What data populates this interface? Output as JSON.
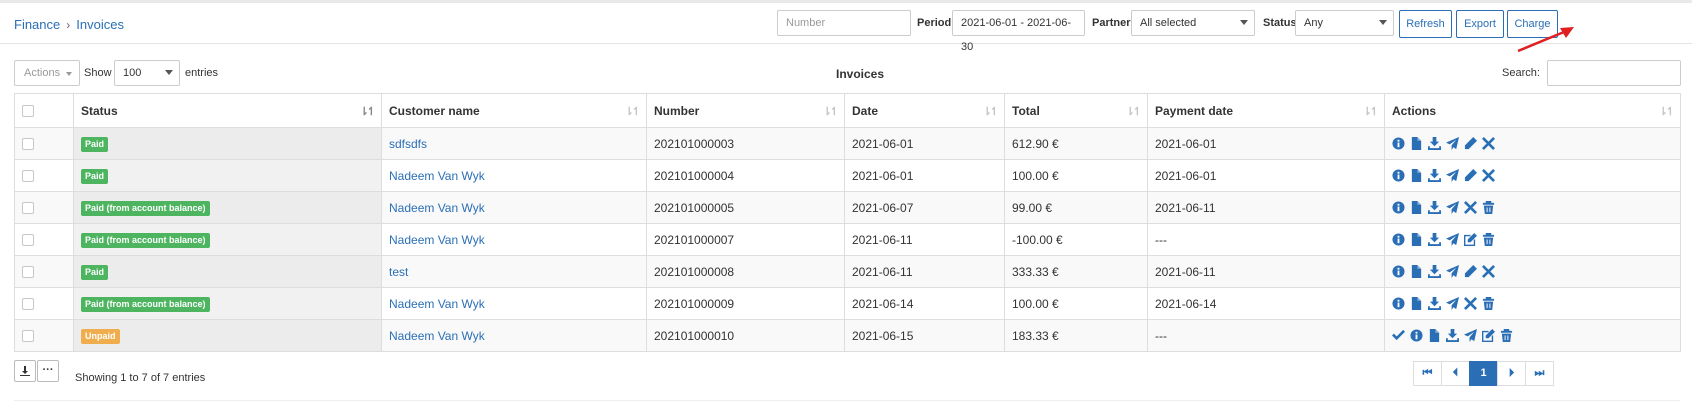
{
  "breadcrumb": {
    "parent": "Finance",
    "separator": "›",
    "current": "Invoices"
  },
  "filters": {
    "number_placeholder": "Number",
    "period_label": "Period",
    "period_value": "2021-06-01 - 2021-06-30",
    "partner_label": "Partner",
    "partner_value": "All selected",
    "status_label": "Status",
    "status_value": "Any"
  },
  "header_buttons": {
    "refresh": "Refresh",
    "export": "Export",
    "charge": "Charge"
  },
  "controls": {
    "actions_label": "Actions",
    "show_label": "Show",
    "entries_value": "100",
    "entries_label": "entries",
    "table_title": "Invoices",
    "search_label": "Search:"
  },
  "columns": [
    "Status",
    "Customer name",
    "Number",
    "Date",
    "Total",
    "Payment date",
    "Actions"
  ],
  "rows": [
    {
      "status": "Paid",
      "status_type": "paid",
      "customer": "sdfsdfs",
      "number": "202101000003",
      "date": "2021-06-01",
      "total": "612.90 €",
      "payment_date": "2021-06-01",
      "actions": [
        "info-icon",
        "document-icon",
        "download-icon",
        "send-icon",
        "pencil-icon",
        "close-icon"
      ]
    },
    {
      "status": "Paid",
      "status_type": "paid",
      "customer": "Nadeem Van Wyk",
      "number": "202101000004",
      "date": "2021-06-01",
      "total": "100.00 €",
      "payment_date": "2021-06-01",
      "actions": [
        "info-icon",
        "document-icon",
        "download-icon",
        "send-icon",
        "pencil-icon",
        "close-icon"
      ]
    },
    {
      "status": "Paid (from account balance)",
      "status_type": "paid",
      "customer": "Nadeem Van Wyk",
      "number": "202101000005",
      "date": "2021-06-07",
      "total": "99.00 €",
      "payment_date": "2021-06-11",
      "actions": [
        "info-icon",
        "document-icon",
        "download-icon",
        "send-icon",
        "close-icon",
        "trash-icon"
      ]
    },
    {
      "status": "Paid (from account balance)",
      "status_type": "paid",
      "customer": "Nadeem Van Wyk",
      "number": "202101000007",
      "date": "2021-06-11",
      "total": "-100.00 €",
      "payment_date": "---",
      "actions": [
        "info-icon",
        "document-icon",
        "download-icon",
        "send-icon",
        "edit-icon",
        "trash-icon"
      ]
    },
    {
      "status": "Paid",
      "status_type": "paid",
      "customer": "test",
      "number": "202101000008",
      "date": "2021-06-11",
      "total": "333.33 €",
      "payment_date": "2021-06-11",
      "actions": [
        "info-icon",
        "document-icon",
        "download-icon",
        "send-icon",
        "pencil-icon",
        "close-icon"
      ]
    },
    {
      "status": "Paid (from account balance)",
      "status_type": "paid",
      "customer": "Nadeem Van Wyk",
      "number": "202101000009",
      "date": "2021-06-14",
      "total": "100.00 €",
      "payment_date": "2021-06-14",
      "actions": [
        "info-icon",
        "document-icon",
        "download-icon",
        "send-icon",
        "close-icon",
        "trash-icon"
      ]
    },
    {
      "status": "Unpaid",
      "status_type": "unpaid",
      "customer": "Nadeem Van Wyk",
      "number": "202101000010",
      "date": "2021-06-15",
      "total": "183.33 €",
      "payment_date": "---",
      "actions": [
        "check-icon",
        "info-icon",
        "document-icon",
        "download-icon",
        "send-icon",
        "edit-icon",
        "trash-icon"
      ]
    }
  ],
  "footer": {
    "showing": "Showing 1 to 7 of 7 entries",
    "pages": {
      "first": "⏮",
      "prev": "⏴",
      "current": "1",
      "next": "⏵",
      "last": "⏭"
    }
  },
  "colors": {
    "accent": "#2a6fb6",
    "paid": "#4db560",
    "unpaid": "#f0ad4e",
    "arrow": "#e02020"
  }
}
